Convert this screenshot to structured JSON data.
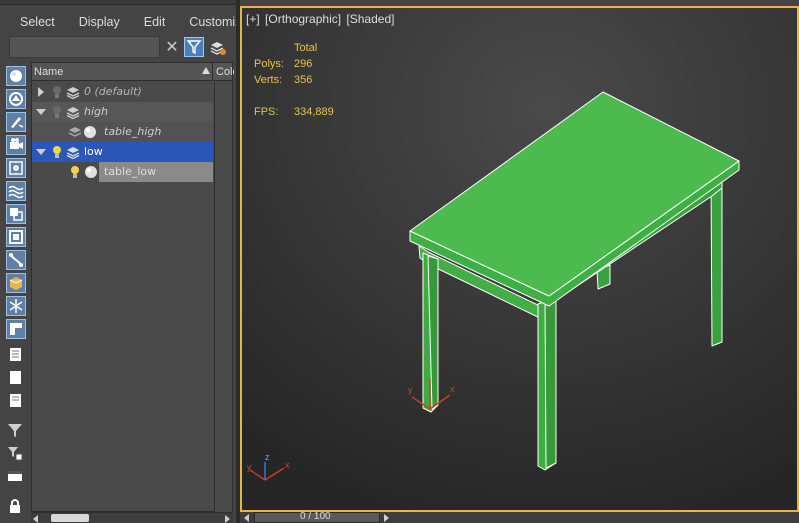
{
  "menu": {
    "items": [
      "Select",
      "Display",
      "Edit",
      "Customize"
    ]
  },
  "search": {
    "value": "",
    "placeholder": ""
  },
  "toolbar": {
    "clear_icon": "close-icon",
    "filter_icon": "filter-icon",
    "layers_icon": "layers-icon",
    "left_tools": [
      "display-geometry-icon",
      "display-shapes-icon",
      "display-lights-icon",
      "display-cameras-icon",
      "display-helpers-icon",
      "display-spacewarps-icon",
      "display-groups-icon",
      "display-xrefs-icon",
      "display-bones-icon",
      "display-containers-icon",
      "display-frozen-icon",
      "display-hidden-icon",
      "display-all-icon",
      "display-none-icon",
      "invert-display-icon",
      "filter-funnel-icon",
      "filter-options-icon",
      "sync-selection-icon",
      "lock-icon"
    ]
  },
  "tree": {
    "columns": {
      "name": "Name",
      "color": "Color"
    },
    "rows": [
      {
        "label": "0 (default)",
        "type": "layer",
        "expanded": false,
        "italic": true
      },
      {
        "label": "high",
        "type": "layer",
        "expanded": true,
        "italic": true
      },
      {
        "label": "table_high",
        "type": "object",
        "italic": true
      },
      {
        "label": "low",
        "type": "layer",
        "expanded": true,
        "selected": true
      },
      {
        "label": "table_low",
        "type": "object"
      }
    ]
  },
  "viewport": {
    "labels": [
      "[+]",
      "[Orthographic]",
      "[Shaded]"
    ],
    "stats": {
      "header": "Total",
      "polys_label": "Polys:",
      "polys_value": "296",
      "verts_label": "Verts:",
      "verts_value": "356",
      "fps_label": "FPS:",
      "fps_value": "334,889"
    },
    "object_color": "#4cba4e",
    "stats_color": "#e8c34a",
    "border_color": "#e7b446",
    "gizmo": {
      "x": "x",
      "y": "y",
      "z": "z"
    }
  },
  "timeline": {
    "text": "0 / 100"
  }
}
